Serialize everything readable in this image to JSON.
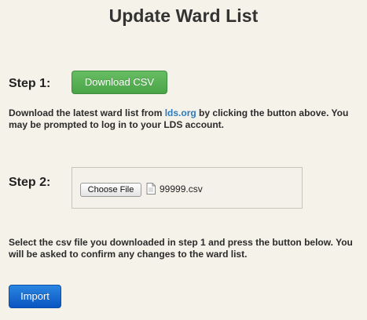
{
  "page": {
    "title": "Update Ward List"
  },
  "step1": {
    "label": "Step 1:",
    "button_label": "Download CSV",
    "text_before_link": "Download the latest ward list from ",
    "link_text": "lds.org",
    "text_after_link": " by clicking the button above. You may be prompted to log in to your LDS account."
  },
  "step2": {
    "label": "Step 2:",
    "choose_file_label": "Choose File",
    "file_icon": "document-icon",
    "selected_file": "99999.csv"
  },
  "instructions": {
    "text": "Select the csv file you downloaded in step 1 and press the button below. You will be asked to confirm any changes to the ward list."
  },
  "import_button": {
    "label": "Import"
  },
  "colors": {
    "background": "#f5f2ea",
    "download_button": "#4aa447",
    "import_button": "#0a55c2",
    "link": "#2a7bbf"
  }
}
